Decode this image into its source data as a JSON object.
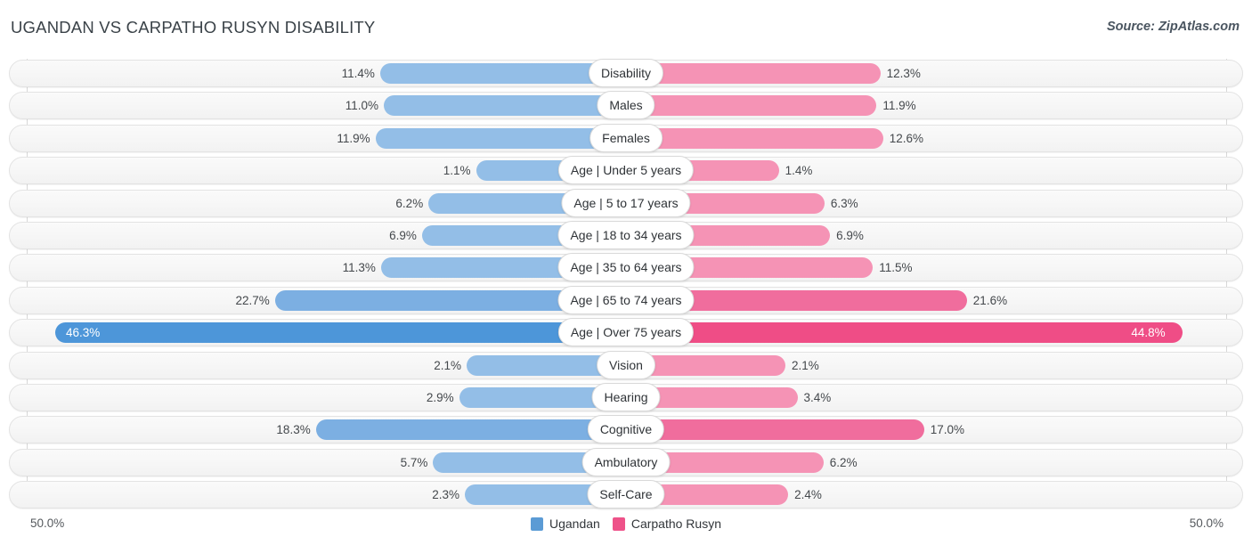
{
  "header": {
    "title": "UGANDAN VS CARPATHO RUSYN DISABILITY",
    "source": "Source: ZipAtlas.com"
  },
  "axis": {
    "left_label": "50.0%",
    "right_label": "50.0%",
    "max": 50.0
  },
  "legend": {
    "items": [
      {
        "label": "Ugandan",
        "color": "#5B9BD5"
      },
      {
        "label": "Carpatho Rusyn",
        "color": "#EE5289"
      }
    ]
  },
  "chart_data": {
    "type": "bar",
    "title": "UGANDAN VS CARPATHO RUSYN DISABILITY",
    "subtitle": "",
    "xlabel": "",
    "ylabel": "",
    "orientation": "horizontal-diverging",
    "xlim": [
      50.0,
      50.0
    ],
    "grid": true,
    "legend_position": "bottom-center",
    "categories": [
      "Disability",
      "Males",
      "Females",
      "Age | Under 5 years",
      "Age | 5 to 17 years",
      "Age | 18 to 34 years",
      "Age | 35 to 64 years",
      "Age | 65 to 74 years",
      "Age | Over 75 years",
      "Vision",
      "Hearing",
      "Cognitive",
      "Ambulatory",
      "Self-Care"
    ],
    "series": [
      {
        "name": "Ugandan",
        "color": "#5B9BD5",
        "values": [
          11.4,
          11.0,
          11.9,
          1.1,
          6.2,
          6.9,
          11.3,
          22.7,
          46.3,
          2.1,
          2.9,
          18.3,
          5.7,
          2.3
        ],
        "labels": [
          "11.4%",
          "11.0%",
          "11.9%",
          "1.1%",
          "6.2%",
          "6.9%",
          "11.3%",
          "22.7%",
          "46.3%",
          "2.1%",
          "2.9%",
          "18.3%",
          "5.7%",
          "2.3%"
        ]
      },
      {
        "name": "Carpatho Rusyn",
        "color": "#EE5289",
        "values": [
          12.3,
          11.9,
          12.6,
          1.4,
          6.3,
          6.9,
          11.5,
          21.6,
          44.8,
          2.1,
          3.4,
          17.0,
          6.2,
          2.4
        ],
        "labels": [
          "12.3%",
          "11.9%",
          "12.6%",
          "1.4%",
          "6.3%",
          "6.9%",
          "11.5%",
          "21.6%",
          "44.8%",
          "2.1%",
          "3.4%",
          "17.0%",
          "6.2%",
          "2.4%"
        ]
      }
    ]
  },
  "rows": [
    {
      "label": "Disability",
      "left_value": 11.4,
      "left_label": "11.4%",
      "right_value": 12.3,
      "right_label": "12.3%",
      "emphasis": "normal"
    },
    {
      "label": "Males",
      "left_value": 11.0,
      "left_label": "11.0%",
      "right_value": 11.9,
      "right_label": "11.9%",
      "emphasis": "normal"
    },
    {
      "label": "Females",
      "left_value": 11.9,
      "left_label": "11.9%",
      "right_value": 12.6,
      "right_label": "12.6%",
      "emphasis": "normal"
    },
    {
      "label": "Age | Under 5 years",
      "left_value": 1.1,
      "left_label": "1.1%",
      "right_value": 1.4,
      "right_label": "1.4%",
      "emphasis": "normal"
    },
    {
      "label": "Age | 5 to 17 years",
      "left_value": 6.2,
      "left_label": "6.2%",
      "right_value": 6.3,
      "right_label": "6.3%",
      "emphasis": "normal"
    },
    {
      "label": "Age | 18 to 34 years",
      "left_value": 6.9,
      "left_label": "6.9%",
      "right_value": 6.9,
      "right_label": "6.9%",
      "emphasis": "normal"
    },
    {
      "label": "Age | 35 to 64 years",
      "left_value": 11.3,
      "left_label": "11.3%",
      "right_value": 11.5,
      "right_label": "11.5%",
      "emphasis": "normal"
    },
    {
      "label": "Age | 65 to 74 years",
      "left_value": 22.7,
      "left_label": "22.7%",
      "right_value": 21.6,
      "right_label": "21.6%",
      "emphasis": "medium"
    },
    {
      "label": "Age | Over 75 years",
      "left_value": 46.3,
      "left_label": "46.3%",
      "right_value": 44.8,
      "right_label": "44.8%",
      "emphasis": "high"
    },
    {
      "label": "Vision",
      "left_value": 2.1,
      "left_label": "2.1%",
      "right_value": 2.1,
      "right_label": "2.1%",
      "emphasis": "normal"
    },
    {
      "label": "Hearing",
      "left_value": 2.9,
      "left_label": "2.9%",
      "right_value": 3.4,
      "right_label": "3.4%",
      "emphasis": "normal"
    },
    {
      "label": "Cognitive",
      "left_value": 18.3,
      "left_label": "18.3%",
      "right_value": 17.0,
      "right_label": "17.0%",
      "emphasis": "medium"
    },
    {
      "label": "Ambulatory",
      "left_value": 5.7,
      "left_label": "5.7%",
      "right_value": 6.2,
      "right_label": "6.2%",
      "emphasis": "normal"
    },
    {
      "label": "Self-Care",
      "left_value": 2.3,
      "left_label": "2.3%",
      "right_value": 2.4,
      "right_label": "2.4%",
      "emphasis": "normal"
    }
  ],
  "colors": {
    "blue_normal": "#93BEE7",
    "blue_medium": "#7CAFE2",
    "blue_high": "#4D96D9",
    "pink_normal": "#F593B5",
    "pink_medium": "#F06D9D",
    "pink_high": "#EF4D86",
    "track_bg": "#F7F7F7",
    "gridline": "#D8D8D8"
  }
}
